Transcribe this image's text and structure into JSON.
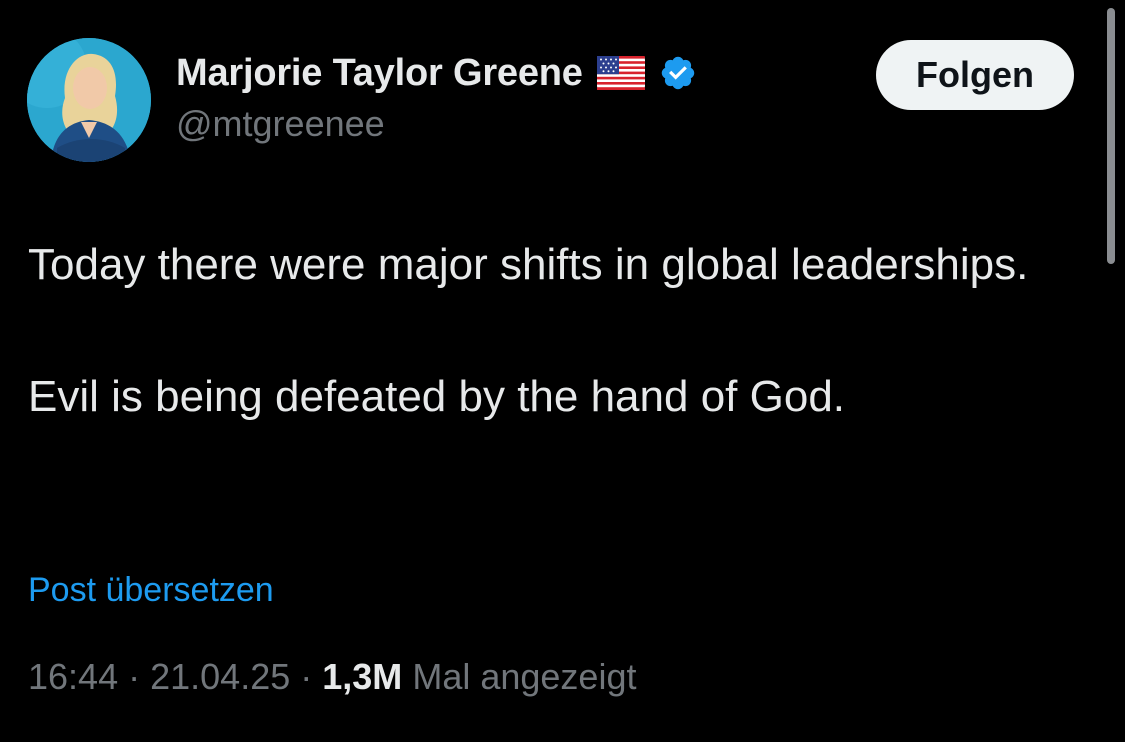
{
  "author": {
    "display_name": "Marjorie Taylor Greene",
    "handle": "@mtgreenee",
    "avatar_icon": "profile-photo",
    "flag_icon": "us-flag-emoji",
    "verified_icon": "verified-badge",
    "verified_color": "#1d9bf0"
  },
  "actions": {
    "follow_label": "Folgen",
    "translate_label": "Post übersetzen"
  },
  "tweet": {
    "paragraphs": [
      "Today there were major shifts in global leaderships.",
      "Evil is being defeated by the hand of God."
    ]
  },
  "meta": {
    "time": "16:44",
    "separator": "·",
    "date": "21.04.25",
    "views_count": "1,3M",
    "views_label": "Mal angezeigt"
  },
  "colors": {
    "background": "#000000",
    "text_primary": "#e7e9ea",
    "text_secondary": "#71767b",
    "link": "#1d9bf0",
    "button_bg": "#eff3f4"
  }
}
